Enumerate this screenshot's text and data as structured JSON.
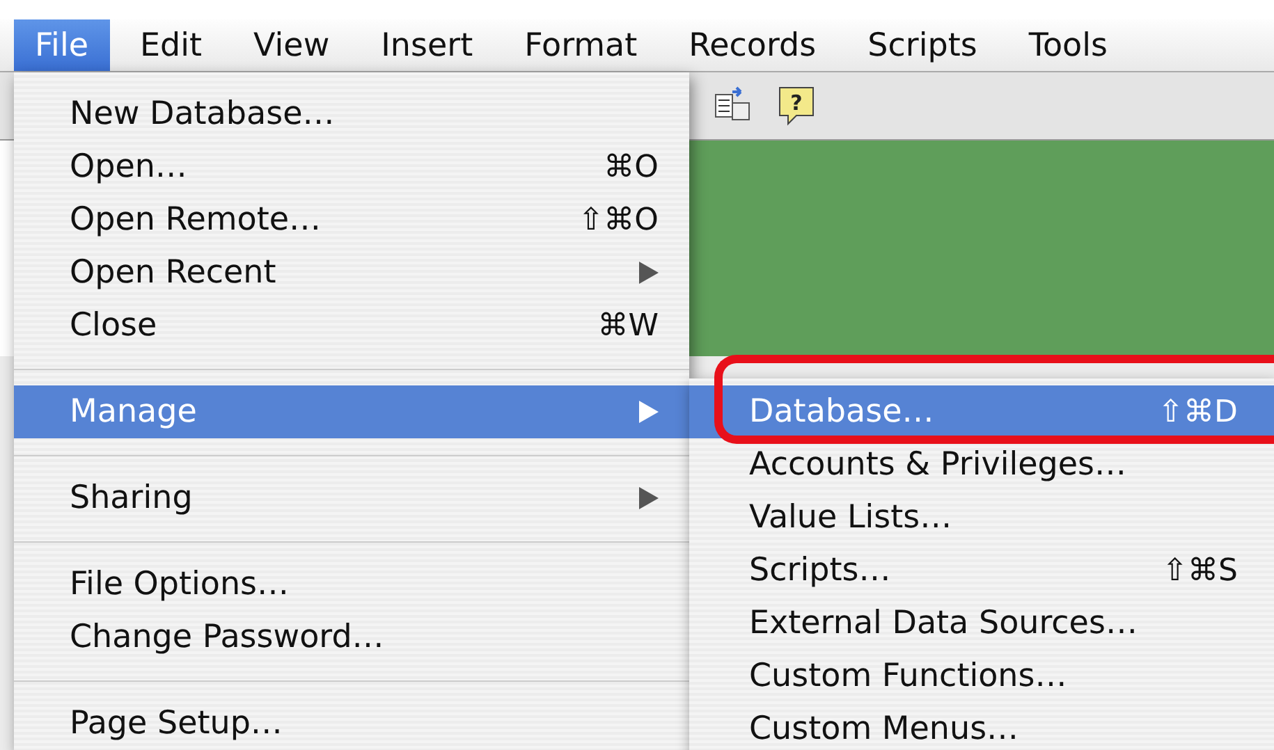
{
  "menu_bar": [
    {
      "label": "File",
      "selected": true
    },
    {
      "label": "Edit",
      "selected": false
    },
    {
      "label": "View",
      "selected": false
    },
    {
      "label": "Insert",
      "selected": false
    },
    {
      "label": "Format",
      "selected": false
    },
    {
      "label": "Records",
      "selected": false
    },
    {
      "label": "Scripts",
      "selected": false
    },
    {
      "label": "Tools",
      "selected": false
    }
  ],
  "file_menu": [
    {
      "kind": "item",
      "label": "New Database…",
      "selected": false,
      "submenu": false
    },
    {
      "kind": "item",
      "label": "Open…",
      "shortcut": "⌘O",
      "selected": false,
      "submenu": false
    },
    {
      "kind": "item",
      "label": "Open Remote…",
      "shortcut": "⇧⌘O",
      "selected": false,
      "submenu": false
    },
    {
      "kind": "item",
      "label": "Open Recent",
      "selected": false,
      "submenu": true
    },
    {
      "kind": "item",
      "label": "Close",
      "shortcut": "⌘W",
      "selected": false,
      "submenu": false
    },
    {
      "kind": "separator"
    },
    {
      "kind": "item",
      "label": "Manage",
      "selected": true,
      "submenu": true
    },
    {
      "kind": "separator"
    },
    {
      "kind": "item",
      "label": "Sharing",
      "selected": false,
      "submenu": true
    },
    {
      "kind": "separator"
    },
    {
      "kind": "item",
      "label": "File Options…",
      "selected": false,
      "submenu": false
    },
    {
      "kind": "item",
      "label": "Change Password…",
      "selected": false,
      "submenu": false
    },
    {
      "kind": "separator"
    },
    {
      "kind": "item",
      "label": "Page Setup…",
      "selected": false,
      "submenu": false
    }
  ],
  "manage_submenu": [
    {
      "kind": "item",
      "label": "Database…",
      "shortcut": "⇧⌘D",
      "selected": true
    },
    {
      "kind": "item",
      "label": "Accounts & Privileges…",
      "selected": false
    },
    {
      "kind": "item",
      "label": "Value Lists…",
      "selected": false
    },
    {
      "kind": "item",
      "label": "Scripts…",
      "shortcut": "⇧⌘S",
      "selected": false
    },
    {
      "kind": "item",
      "label": "External Data Sources…",
      "selected": false
    },
    {
      "kind": "item",
      "label": "Custom Functions…",
      "selected": false
    },
    {
      "kind": "item",
      "label": "Custom Menus…",
      "selected": false
    }
  ],
  "toolbar": {
    "help_glyph": "?"
  }
}
